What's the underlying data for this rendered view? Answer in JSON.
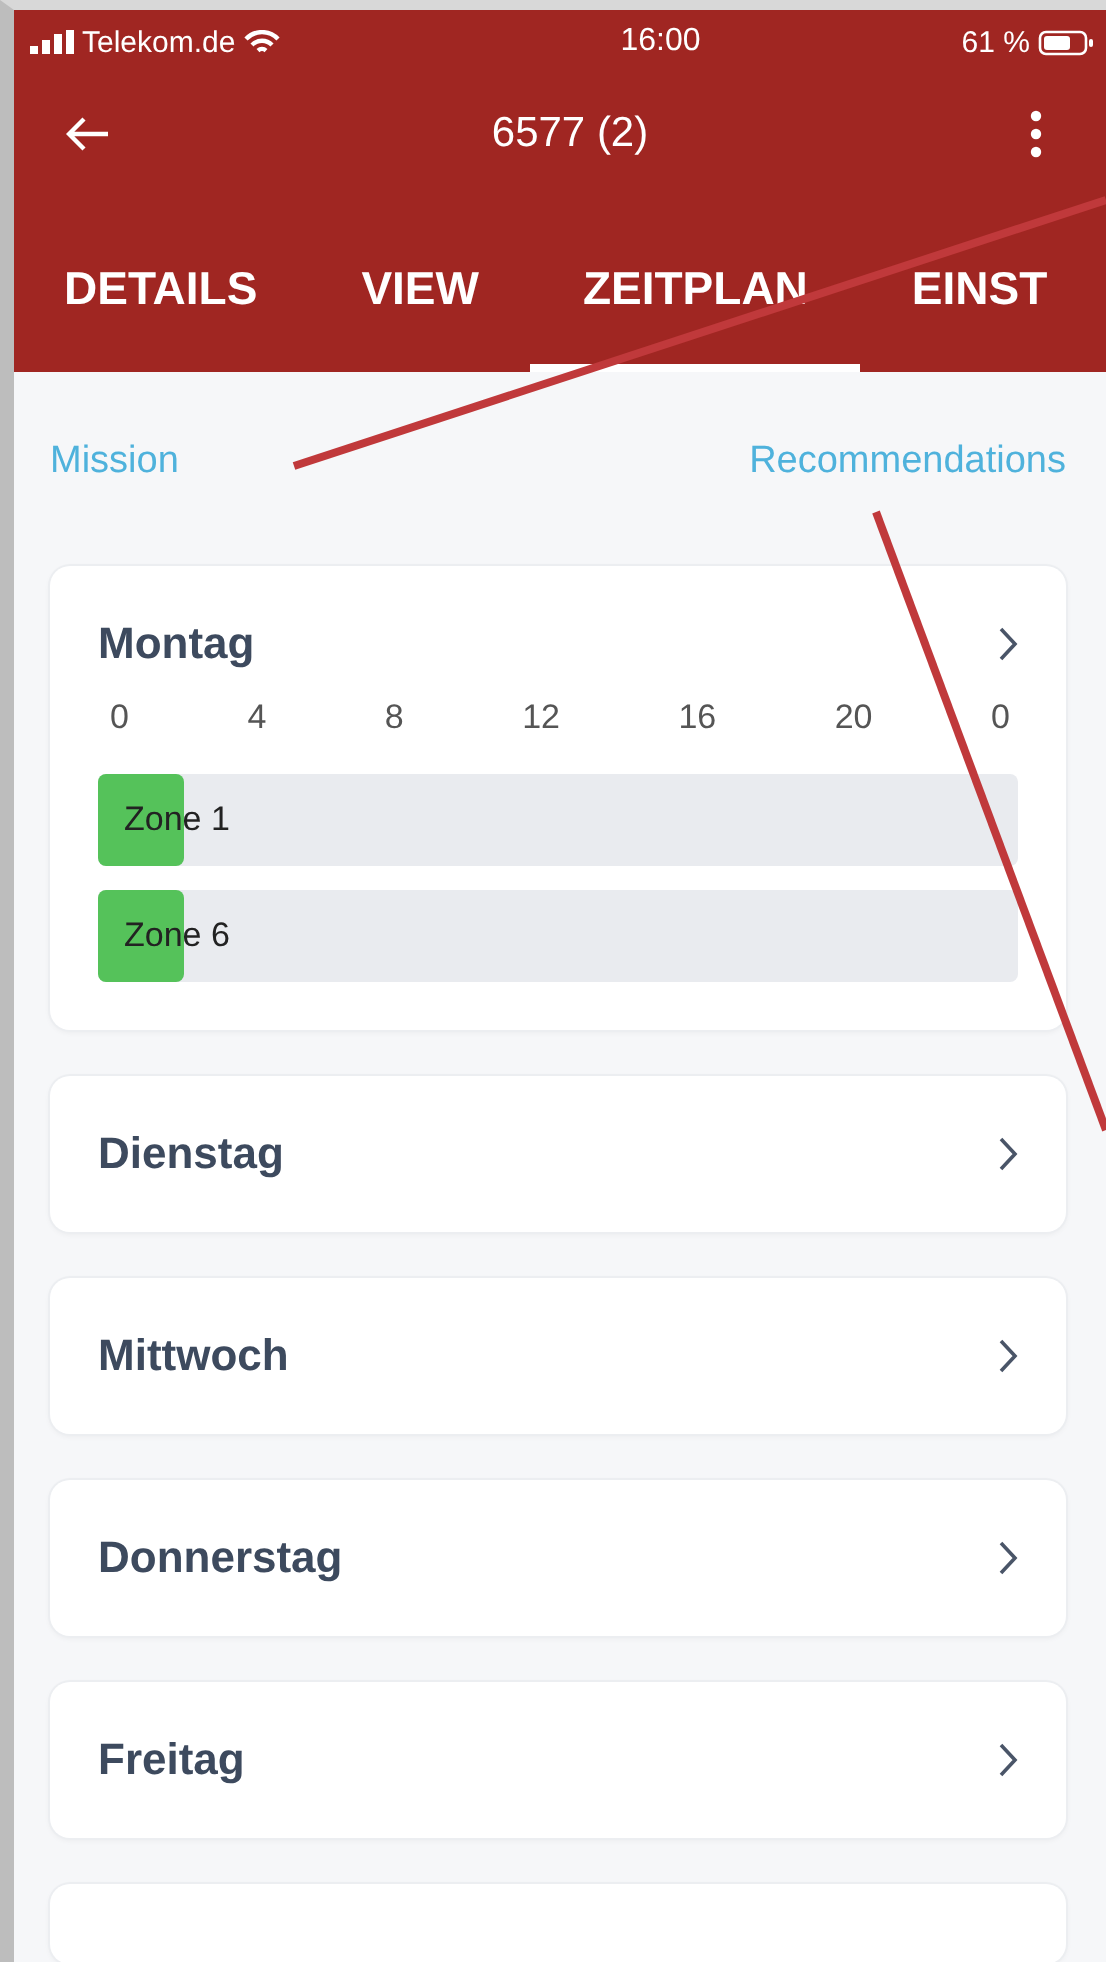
{
  "status_bar": {
    "carrier": "Telekom.de",
    "time": "16:00",
    "battery": "61 %"
  },
  "toolbar": {
    "title": "6577 (2)"
  },
  "tabs": [
    {
      "label": "DETAILS",
      "selected": false
    },
    {
      "label": "VIEW",
      "selected": false
    },
    {
      "label": "ZEITPLAN",
      "selected": true
    },
    {
      "label": "EINST",
      "selected": false
    }
  ],
  "links": [
    "Mission",
    "Recommendations"
  ],
  "days": [
    {
      "name": "Montag",
      "expanded": true,
      "axis": [
        "0",
        "4",
        "8",
        "12",
        "16",
        "20",
        "0"
      ],
      "zones": [
        {
          "label": "Zone 1",
          "level": 0.094
        },
        {
          "label": "Zone 6",
          "level": 0.094
        }
      ]
    },
    {
      "name": "Dienstag",
      "expanded": false
    },
    {
      "name": "Mittwoch",
      "expanded": false
    },
    {
      "name": "Donnerstag",
      "expanded": false
    },
    {
      "name": "Freitag",
      "expanded": false
    }
  ]
}
